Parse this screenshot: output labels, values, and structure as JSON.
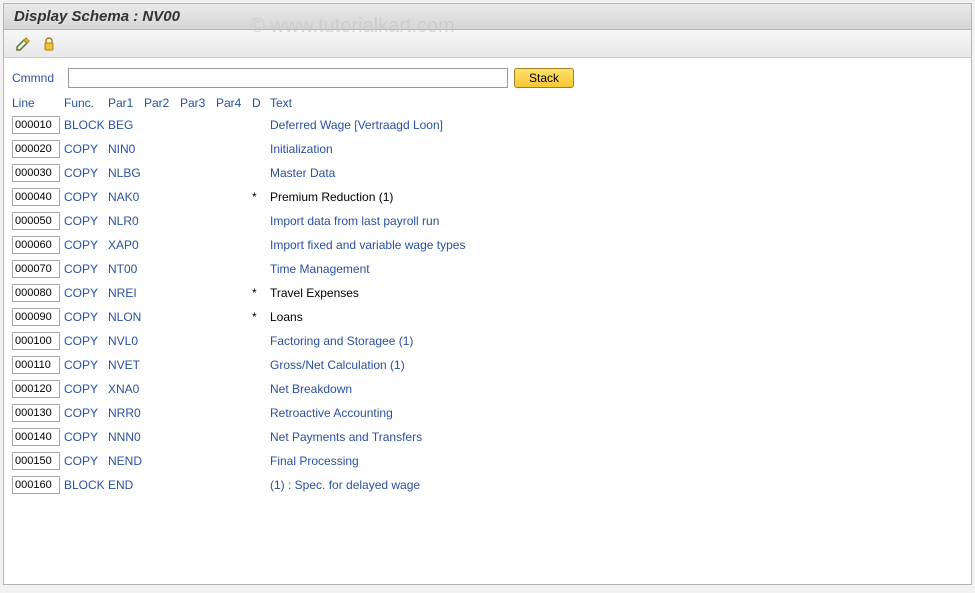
{
  "window": {
    "title": "Display Schema : NV00"
  },
  "watermark": "© www.tutorialkart.com",
  "command": {
    "label": "Cmmnd",
    "value": "",
    "stack_label": "Stack"
  },
  "headers": {
    "line": "Line",
    "func": "Func.",
    "par1": "Par1",
    "par2": "Par2",
    "par3": "Par3",
    "par4": "Par4",
    "d": "D",
    "text": "Text"
  },
  "rows": [
    {
      "line": "000010",
      "func": "BLOCK",
      "par1": "BEG",
      "d": "",
      "text": "Deferred Wage [Vertraagd Loon]",
      "link": true
    },
    {
      "line": "000020",
      "func": "COPY",
      "par1": "NIN0",
      "d": "",
      "text": "Initialization",
      "link": true
    },
    {
      "line": "000030",
      "func": "COPY",
      "par1": "NLBG",
      "d": "",
      "text": "Master Data",
      "link": true
    },
    {
      "line": "000040",
      "func": "COPY",
      "par1": "NAK0",
      "d": "*",
      "text": "Premium Reduction (1)",
      "link": false
    },
    {
      "line": "000050",
      "func": "COPY",
      "par1": "NLR0",
      "d": "",
      "text": "Import data from last payroll run",
      "link": true
    },
    {
      "line": "000060",
      "func": "COPY",
      "par1": "XAP0",
      "d": "",
      "text": "Import fixed and variable wage types",
      "link": true
    },
    {
      "line": "000070",
      "func": "COPY",
      "par1": "NT00",
      "d": "",
      "text": "Time Management",
      "link": true
    },
    {
      "line": "000080",
      "func": "COPY",
      "par1": "NREI",
      "d": "*",
      "text": "Travel Expenses",
      "link": false
    },
    {
      "line": "000090",
      "func": "COPY",
      "par1": "NLON",
      "d": "*",
      "text": "Loans",
      "link": false
    },
    {
      "line": "000100",
      "func": "COPY",
      "par1": "NVL0",
      "d": "",
      "text": "Factoring and Storagee (1)",
      "link": true
    },
    {
      "line": "000110",
      "func": "COPY",
      "par1": "NVET",
      "d": "",
      "text": "Gross/Net Calculation (1)",
      "link": true
    },
    {
      "line": "000120",
      "func": "COPY",
      "par1": "XNA0",
      "d": "",
      "text": "Net Breakdown",
      "link": true
    },
    {
      "line": "000130",
      "func": "COPY",
      "par1": "NRR0",
      "d": "",
      "text": "Retroactive Accounting",
      "link": true
    },
    {
      "line": "000140",
      "func": "COPY",
      "par1": "NNN0",
      "d": "",
      "text": "Net Payments and Transfers",
      "link": true
    },
    {
      "line": "000150",
      "func": "COPY",
      "par1": "NEND",
      "d": "",
      "text": "Final Processing",
      "link": true
    },
    {
      "line": "000160",
      "func": "BLOCK",
      "par1": "END",
      "d": "",
      "text": "(1) : Spec. for delayed wage",
      "link": true
    }
  ]
}
